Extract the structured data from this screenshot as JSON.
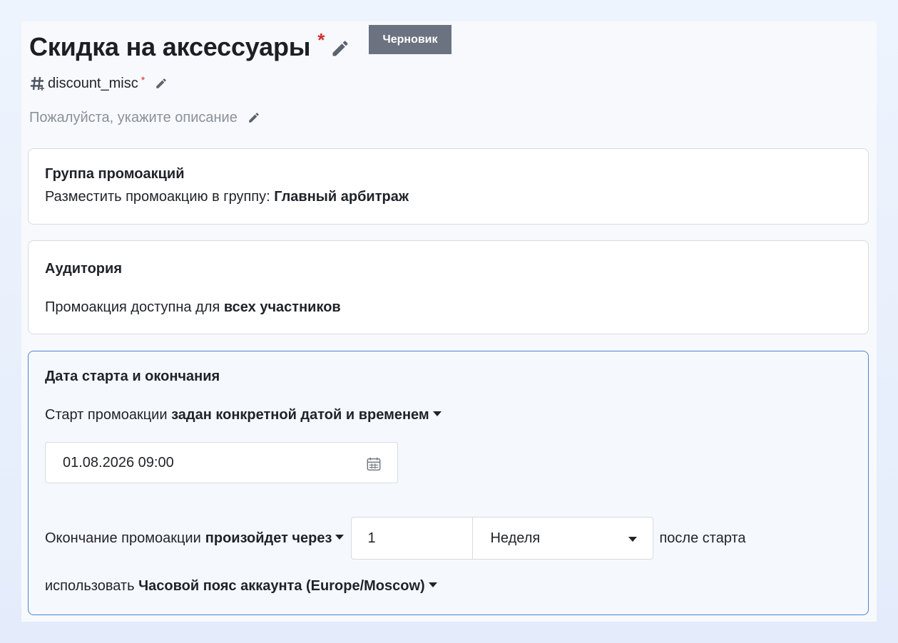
{
  "header": {
    "title": "Скидка на аксессуары",
    "required_mark": "*",
    "status_badge": "Черновик",
    "code": "discount_misc",
    "code_required_mark": "*",
    "description_placeholder": "Пожалуйста, укажите описание"
  },
  "promo_group": {
    "title": "Группа промоакций",
    "label": "Разместить промоакцию в группу:",
    "value": "Главный арбитраж"
  },
  "audience": {
    "title": "Аудитория",
    "label": "Промоакция доступна для",
    "value": "всех участников"
  },
  "dates": {
    "title": "Дата старта и окончания",
    "start_label": "Старт промоакции",
    "start_mode": "задан конкретной датой и временем",
    "start_datetime": "01.08.2026 09:00",
    "end_label": "Окончание промоакции",
    "end_mode": "произойдет через",
    "end_amount": "1",
    "end_unit": "Неделя",
    "end_suffix": "после старта",
    "timezone_label": "использовать",
    "timezone_value": "Часовой пояс аккаунта (Europe/Moscow)"
  },
  "icons": {
    "edit": "pencil-icon",
    "code": "hashtag-icon",
    "calendar": "calendar-icon",
    "dropdown": "caret-down-icon"
  },
  "colors": {
    "required": "#d32f2f",
    "badge_bg": "#6b7380",
    "active_border": "#4a86cf",
    "placeholder": "#8b919a"
  }
}
